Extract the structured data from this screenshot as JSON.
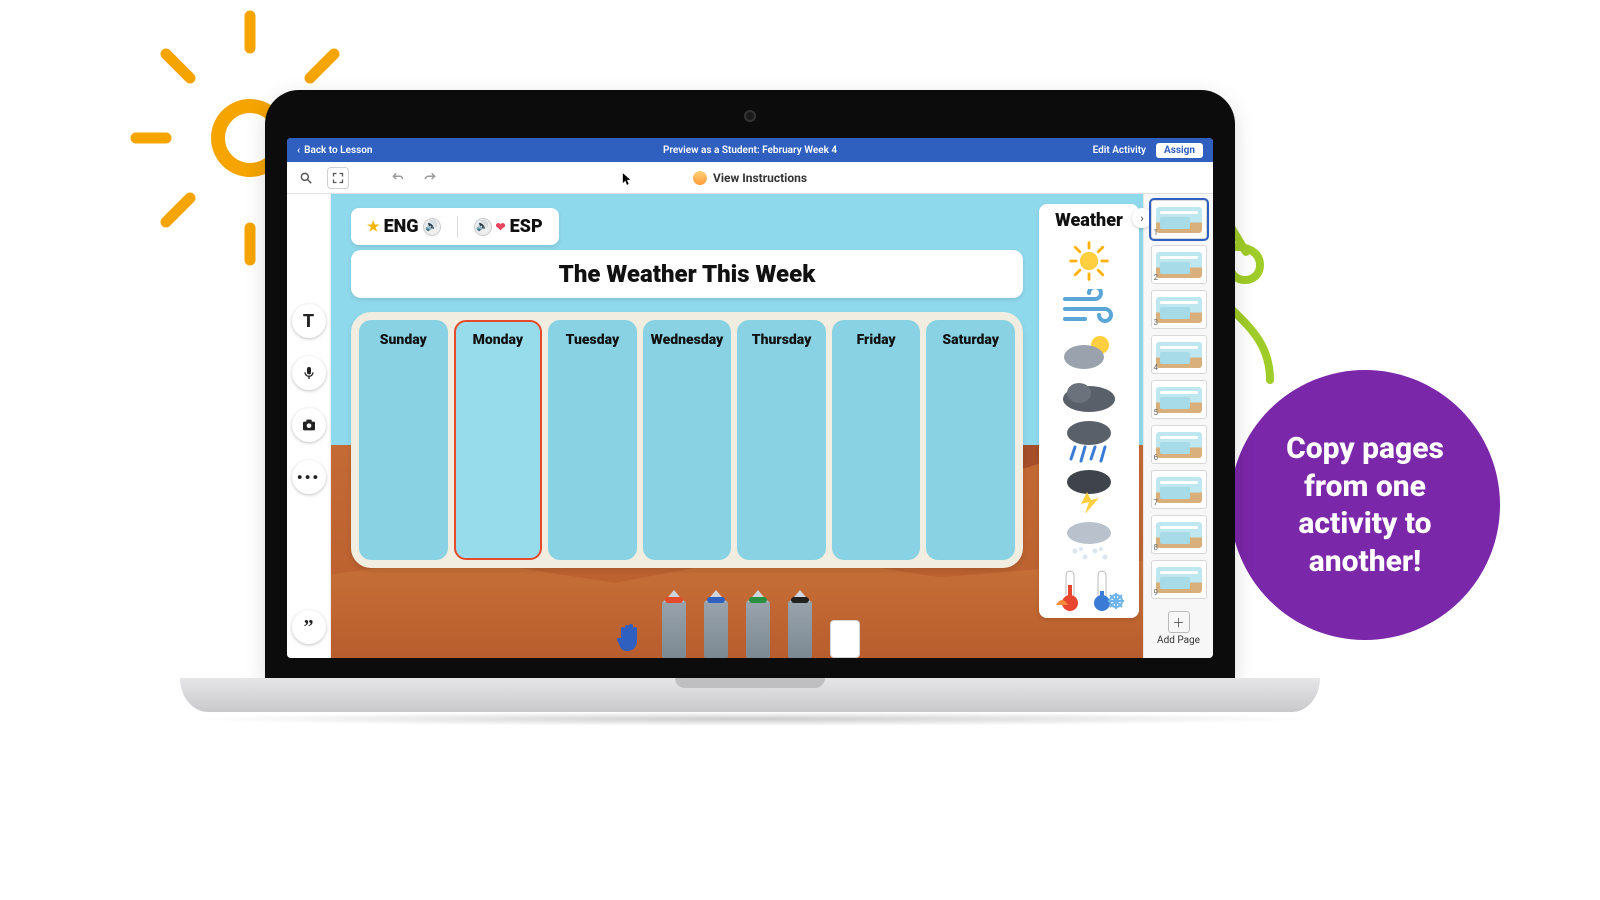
{
  "topbar": {
    "back_label": "Back to Lesson",
    "title": "Preview as a Student: February Week 4",
    "edit_label": "Edit Activity",
    "assign_label": "Assign"
  },
  "toolbar": {
    "view_instructions_label": "View Instructions"
  },
  "language": {
    "eng_label": "ENG",
    "esp_label": "ESP"
  },
  "worksheet": {
    "title_text": "The Weather This Week",
    "days": [
      {
        "label": "Sunday",
        "selected": false
      },
      {
        "label": "Monday",
        "selected": true
      },
      {
        "label": "Tuesday",
        "selected": false
      },
      {
        "label": "Wednesday",
        "selected": false
      },
      {
        "label": "Thursday",
        "selected": false
      },
      {
        "label": "Friday",
        "selected": false
      },
      {
        "label": "Saturday",
        "selected": false
      }
    ]
  },
  "palette": {
    "title": "Weather",
    "items": [
      "sunny",
      "windy",
      "partly-cloudy",
      "cloudy",
      "rainy",
      "thunderstorm",
      "snowy",
      "thermometers"
    ]
  },
  "pentray": {
    "colors": [
      "#e54a2b",
      "#2f5fbf",
      "#2a8f3e",
      "#222222"
    ]
  },
  "left_tools": [
    "text-tool",
    "mic-tool",
    "camera-tool",
    "more-tool",
    "quote-tool"
  ],
  "pages": {
    "items": [
      {
        "n": "1",
        "active": true
      },
      {
        "n": "2",
        "active": false
      },
      {
        "n": "3",
        "active": false
      },
      {
        "n": "4",
        "active": false
      },
      {
        "n": "5",
        "active": false
      },
      {
        "n": "6",
        "active": false
      },
      {
        "n": "7",
        "active": false
      },
      {
        "n": "8",
        "active": false
      },
      {
        "n": "9",
        "active": false
      }
    ],
    "add_label": "Add Page"
  },
  "callout": {
    "text": "Copy pages from one activity to another!"
  },
  "colors": {
    "brand_blue": "#2f5fbf",
    "accent_orange": "#e54a2b",
    "bubble_purple": "#7b27a9",
    "doodle_orange": "#f5a400",
    "doodle_green": "#9fcc28"
  }
}
